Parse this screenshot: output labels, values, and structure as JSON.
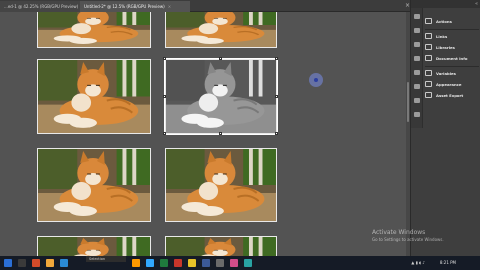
{
  "tabs": [
    {
      "label": "...ed-1 @ 42.25% (RGB/GPU Preview)",
      "close": "×"
    },
    {
      "label": "Untitled-2* @ 12.5% (RGB/GPU Preview)",
      "close": "×"
    }
  ],
  "tab_bar_close": "×",
  "panel": {
    "collapse": "«",
    "items": [
      {
        "label": "Actions",
        "icon": "actions-icon"
      },
      {
        "label": "Links",
        "icon": "links-icon"
      },
      {
        "label": "Libraries",
        "icon": "libraries-icon"
      },
      {
        "label": "Document Info",
        "icon": "document-info-icon"
      },
      {
        "label": "Variables",
        "icon": "variables-icon"
      },
      {
        "label": "Appearance",
        "icon": "appearance-icon"
      },
      {
        "label": "Asset Export",
        "icon": "asset-export-icon"
      }
    ]
  },
  "status": {
    "tool": "Selection"
  },
  "watermark": {
    "line1": "Activate Windows",
    "line2": "Go to Settings to activate Windows."
  },
  "taskbar": {
    "time": "8:21 PM"
  },
  "colors": {
    "canvas": "#535353",
    "panel": "#3e3e3e",
    "taskbar": "#151b26",
    "cat_orange": "#d98a3a"
  }
}
